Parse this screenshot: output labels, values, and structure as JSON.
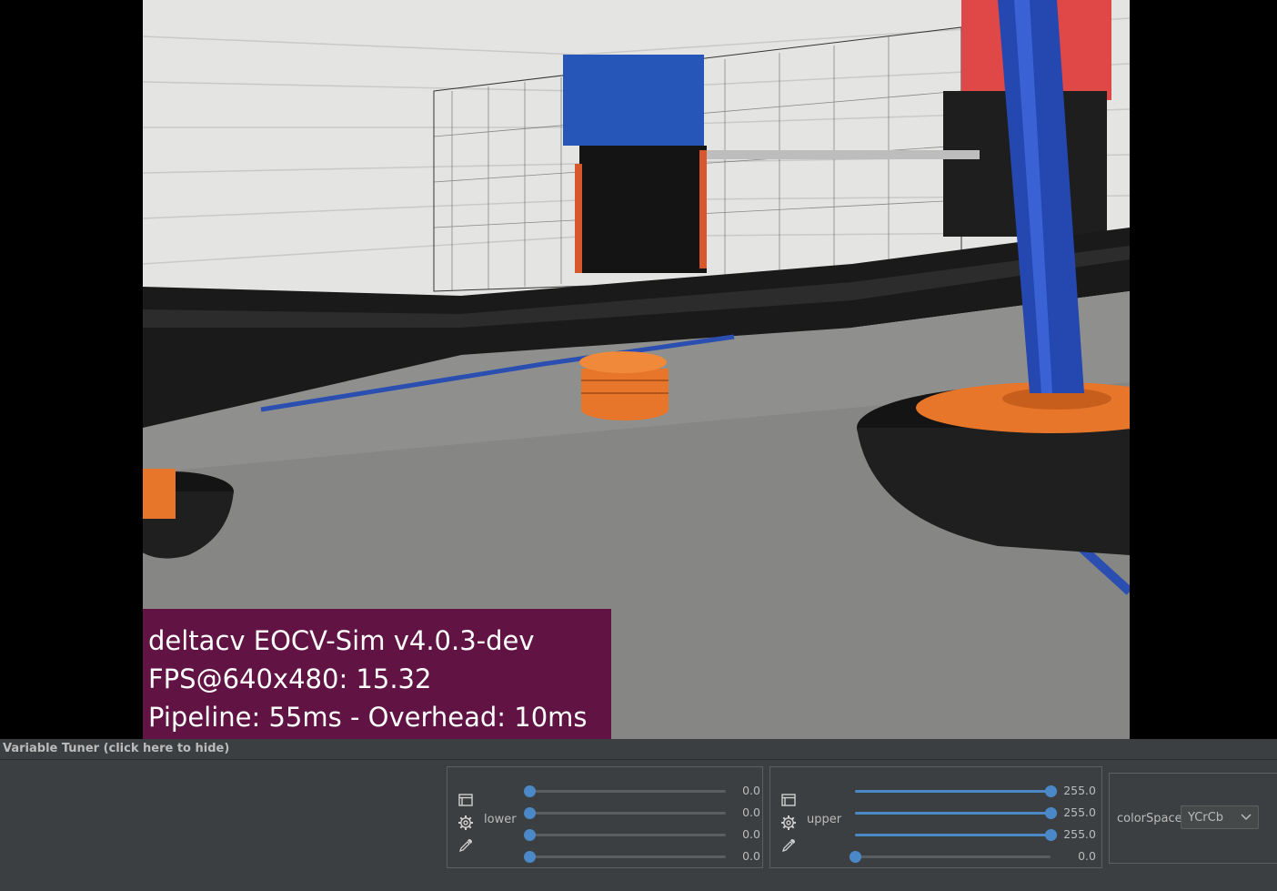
{
  "overlay": {
    "line1": "deltacv EOCV-Sim v4.0.3-dev",
    "line2": "FPS@640x480: 15.32",
    "line3": "Pipeline: 55ms - Overhead: 10ms"
  },
  "tuner": {
    "header": "Variable Tuner (click here to hide)",
    "lower": {
      "label": "lower",
      "sliders": [
        {
          "value": 0.0,
          "text": "0.0"
        },
        {
          "value": 0.0,
          "text": "0.0"
        },
        {
          "value": 0.0,
          "text": "0.0"
        },
        {
          "value": 0.0,
          "text": "0.0"
        }
      ]
    },
    "upper": {
      "label": "upper",
      "sliders": [
        {
          "value": 255.0,
          "text": "255.0"
        },
        {
          "value": 255.0,
          "text": "255.0"
        },
        {
          "value": 255.0,
          "text": "255.0"
        },
        {
          "value": 0.0,
          "text": "0.0"
        }
      ]
    },
    "slider_max": 255.0,
    "colorspace": {
      "label": "colorSpace",
      "selected": "YCrCb"
    }
  },
  "icons": {
    "panel_toggle": "window-icon",
    "config": "gear-icon",
    "picker": "eyedropper-icon"
  },
  "colors": {
    "overlay_bg": "#611443",
    "slider_accent": "#4a88c7",
    "ui_bg": "#3c3f41"
  }
}
